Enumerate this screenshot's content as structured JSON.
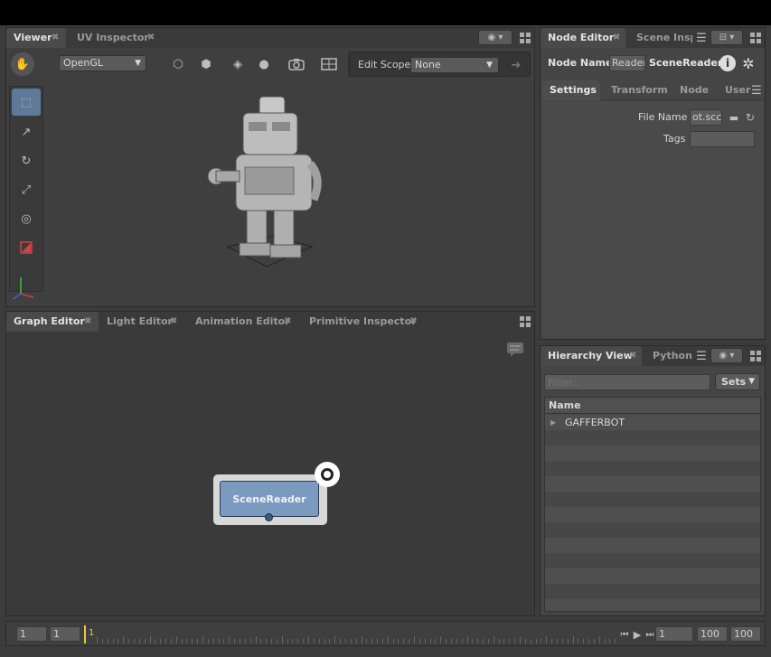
{
  "viewer": {
    "tabs": [
      "Viewer",
      "UV Inspector"
    ],
    "renderer": "OpenGL",
    "edit_scope_label": "Edit Scope",
    "edit_scope_value": "None"
  },
  "graph": {
    "tabs": [
      "Graph Editor",
      "Light Editor",
      "Animation Editor",
      "Primitive Inspector"
    ],
    "node_label": "SceneReader"
  },
  "node_editor": {
    "tabs": [
      "Node Editor",
      "Scene Insp"
    ],
    "node_name_label": "Node Name",
    "node_name_field": "Reader",
    "node_type": "SceneReader",
    "sub_tabs": [
      "Settings",
      "Transform",
      "Node",
      "User"
    ],
    "file_name_label": "File Name",
    "file_name_value": "ot.scc",
    "tags_label": "Tags",
    "tags_value": ""
  },
  "hierarchy": {
    "tabs": [
      "Hierarchy View",
      "Python"
    ],
    "filter_placeholder": "Filter...",
    "sets_label": "Sets",
    "column_name": "Name",
    "items": [
      "GAFFERBOT"
    ]
  },
  "timeline": {
    "start": "1",
    "current_start": "1",
    "playhead": "1",
    "current_frame": "1",
    "end": "100",
    "range_end": "100"
  },
  "colors": {
    "node_fill": "#7a9ac0",
    "playhead": "#e8c93a",
    "axis_x": "#d04040",
    "axis_y": "#40c040",
    "axis_z": "#4060e0"
  }
}
